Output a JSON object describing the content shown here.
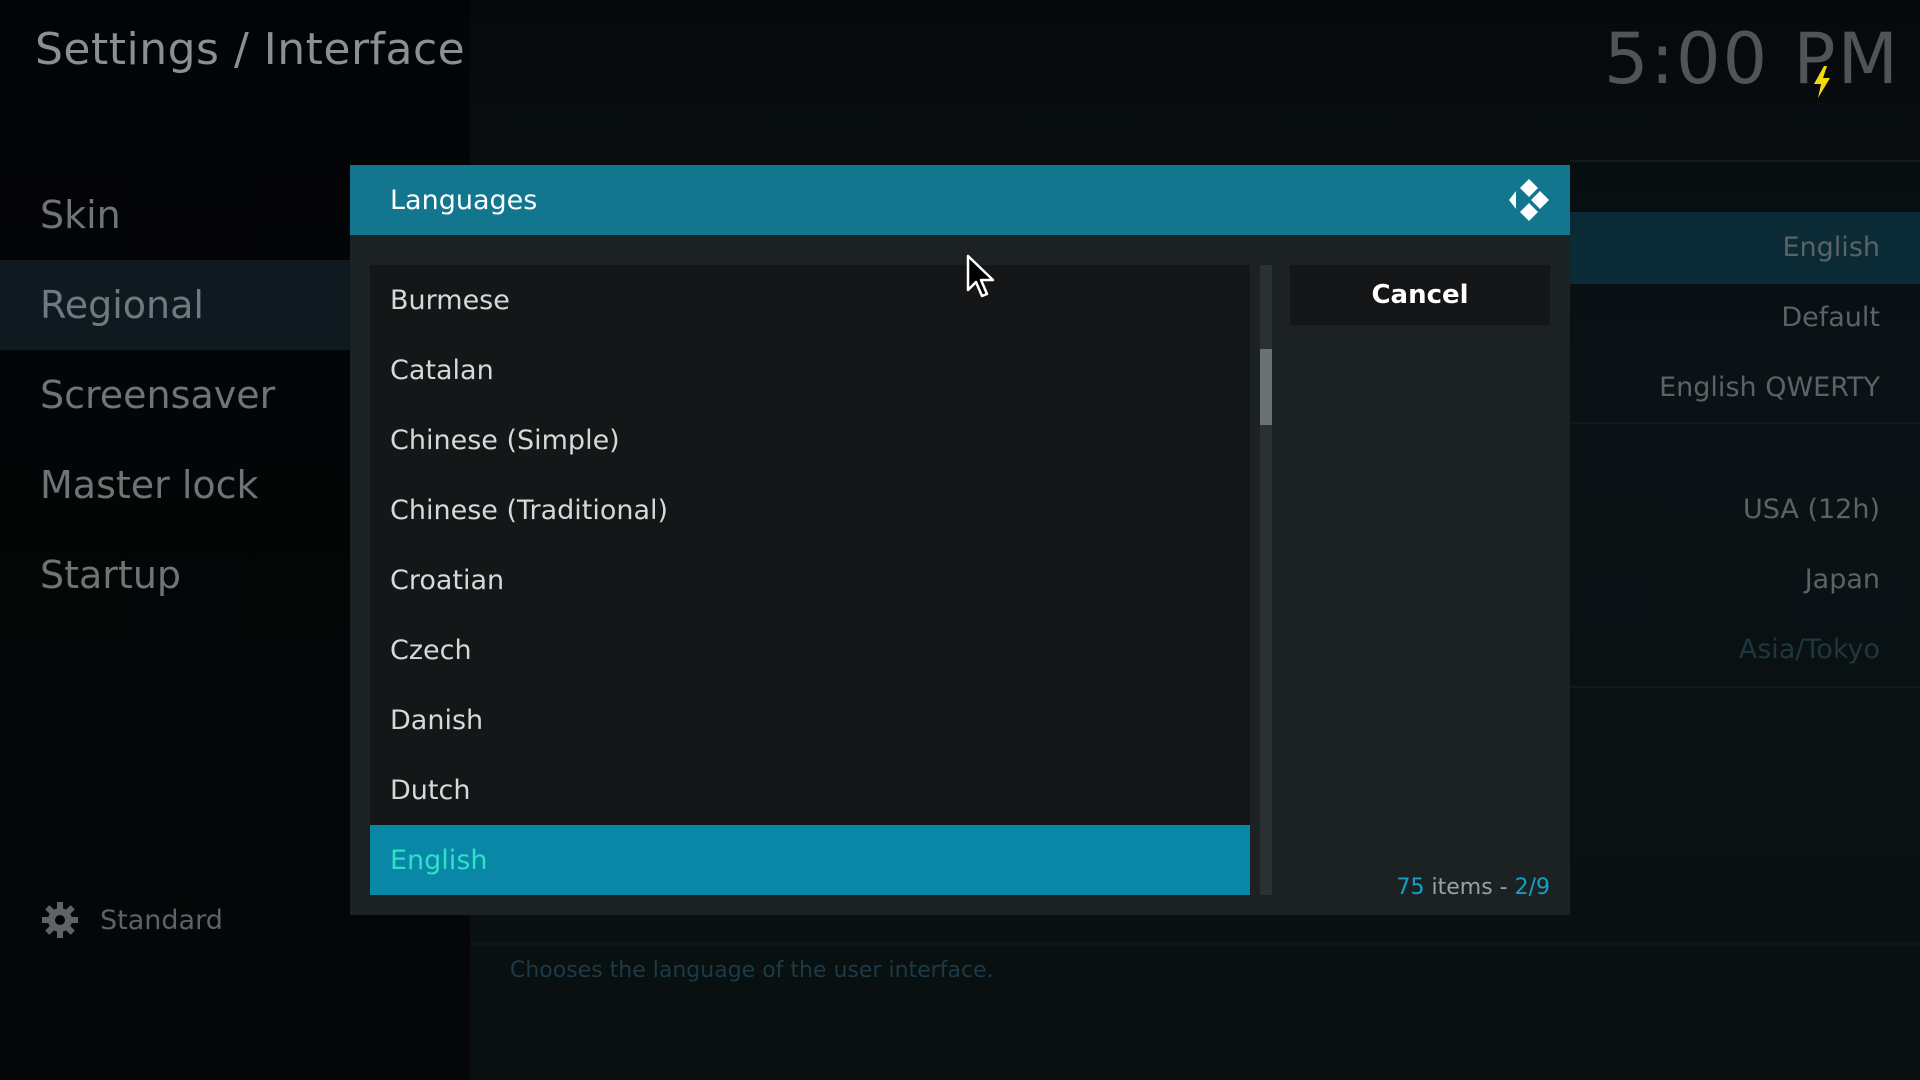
{
  "header": {
    "title": "Settings / Interface",
    "clock": "5:00 PM"
  },
  "sidebar": {
    "items": [
      {
        "label": "Skin"
      },
      {
        "label": "Regional"
      },
      {
        "label": "Screensaver"
      },
      {
        "label": "Master lock"
      },
      {
        "label": "Startup"
      }
    ],
    "active_index": 1,
    "settings_level": "Standard"
  },
  "settings_values": [
    {
      "value": "English"
    },
    {
      "value": "Default"
    },
    {
      "value": "English QWERTY"
    },
    {
      "value": "USA (12h)"
    },
    {
      "value": "Japan"
    },
    {
      "value": "Asia/Tokyo"
    }
  ],
  "description": "Chooses the language of the user interface.",
  "dialog": {
    "title": "Languages",
    "items": [
      {
        "label": "Burmese"
      },
      {
        "label": "Catalan"
      },
      {
        "label": "Chinese (Simple)"
      },
      {
        "label": "Chinese (Traditional)"
      },
      {
        "label": "Croatian"
      },
      {
        "label": "Czech"
      },
      {
        "label": "Danish"
      },
      {
        "label": "Dutch"
      },
      {
        "label": "English"
      }
    ],
    "selected_index": 8,
    "cancel_label": "Cancel",
    "count_number": "75",
    "count_word": " items - ",
    "page": "2/9"
  },
  "colors": {
    "header_bar": "#12768f",
    "selected_row": "#0a86a6",
    "selected_text": "#2fe0c8",
    "accent": "#12a2c6",
    "bolt": "#f5d90a"
  }
}
